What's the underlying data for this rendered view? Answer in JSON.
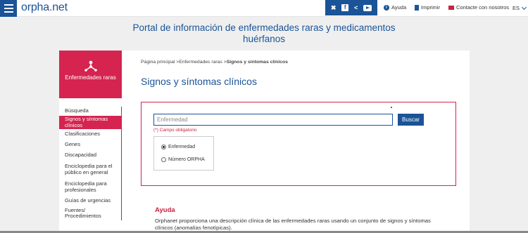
{
  "header": {
    "logo_main": "orpha",
    "logo_dot": ".",
    "logo_end": "net",
    "social_icons": [
      "twitter-icon",
      "facebook-icon",
      "share-icon",
      "youtube-icon"
    ],
    "help_label": "Ayuda",
    "print_label": "Imprimir",
    "contact_label": "Contacte con nosotros",
    "language": "ES"
  },
  "site_title": "Portal de información de enfermedades raras y medicamentos huérfanos",
  "sidebar": {
    "section_label": "Enfermedades raras",
    "items": [
      {
        "label": "Búsqueda",
        "active": false
      },
      {
        "label": "Signos y síntomas clínicos",
        "active": true
      },
      {
        "label": "Clasificaciones",
        "active": false
      },
      {
        "label": "Genes",
        "active": false
      },
      {
        "label": "Discapacidad",
        "active": false
      },
      {
        "label": "Enciclopedia para el público en general",
        "active": false
      },
      {
        "label": "Enciclopedia para profesionales",
        "active": false
      },
      {
        "label": "Guías de urgencias",
        "active": false
      },
      {
        "label": "Fuentes/ Procedimientos",
        "active": false
      }
    ]
  },
  "breadcrumb": {
    "home": "Página principal",
    "sep1": " >",
    "section": "Enfermedades raras",
    "sep2": " >",
    "current": "Signos y síntomas clínicos"
  },
  "page_title": "Signos y síntomas clínicos",
  "search": {
    "value": "",
    "placeholder": "Enfermedad",
    "button_label": "Buscar",
    "required_note": "(*) Campo obligatorio",
    "options": [
      {
        "label": "Enfermedad",
        "selected": true
      },
      {
        "label": "Número ORPHA",
        "selected": false
      }
    ]
  },
  "help": {
    "title": "Ayuda",
    "text": "Orphanet proporciona una descripción clínica de las enfermedades raras usando un conjunto de signos y síntomas clínicos (anomalías fenotípicas)."
  },
  "colors": {
    "brand_blue": "#1a5397",
    "brand_red": "#d4244f"
  }
}
